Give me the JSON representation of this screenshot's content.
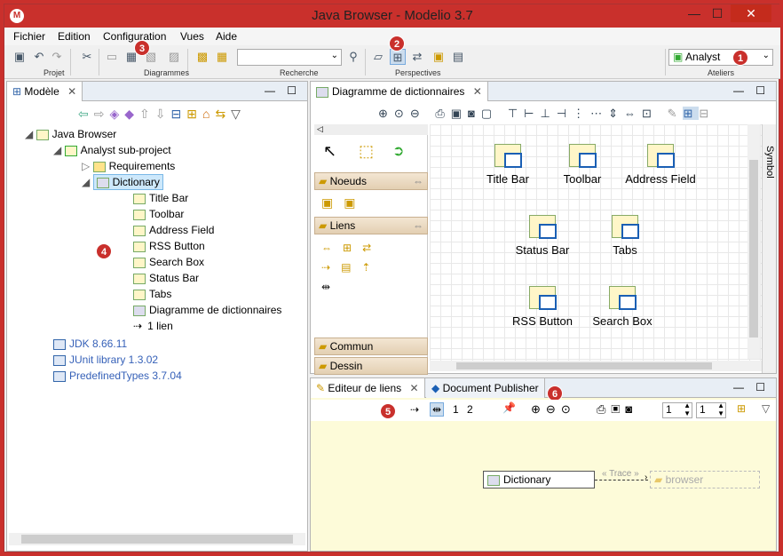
{
  "window": {
    "title": "Java Browser - Modelio 3.7",
    "min": "—",
    "max": "☐",
    "close": "✕"
  },
  "menus": [
    "Fichier",
    "Edition",
    "Configuration",
    "Vues",
    "Aide"
  ],
  "toolbar": {
    "groups": [
      "Projet",
      "Diagrammes",
      "Recherche",
      "Perspectives",
      "Ateliers"
    ],
    "workshop": "Analyst",
    "search_value": ""
  },
  "badges": [
    "1",
    "2",
    "3",
    "4",
    "5",
    "6"
  ],
  "model": {
    "tab": "Modèle",
    "root": "Java Browser",
    "sub": "Analyst sub-project",
    "req": "Requirements",
    "dict": "Dictionary",
    "items": [
      "Title Bar",
      "Toolbar",
      "Address Field",
      "RSS Button",
      "Search Box",
      "Status Bar",
      "Tabs",
      "Diagramme de dictionnaires",
      "1 lien"
    ],
    "libs": [
      "JDK 8.66.11",
      "JUnit library 1.3.02",
      "PredefinedTypes 3.7.04"
    ]
  },
  "diagram": {
    "tab": "Diagramme de dictionnaires",
    "symbol_tab": "Symbol",
    "palette": {
      "noeuds": "Noeuds",
      "liens": "Liens",
      "commun": "Commun",
      "dessin": "Dessin"
    },
    "nodes": [
      "Title Bar",
      "Toolbar",
      "Address Field",
      "Status Bar",
      "Tabs",
      "RSS Button",
      "Search Box"
    ]
  },
  "links": {
    "tab1": "Editeur de liens",
    "tab2": "Document Publisher",
    "n1": "1",
    "n2": "2",
    "spin1": "1",
    "spin2": "1",
    "source": "Dictionary",
    "stereo": "« Trace »",
    "target": "browser"
  }
}
